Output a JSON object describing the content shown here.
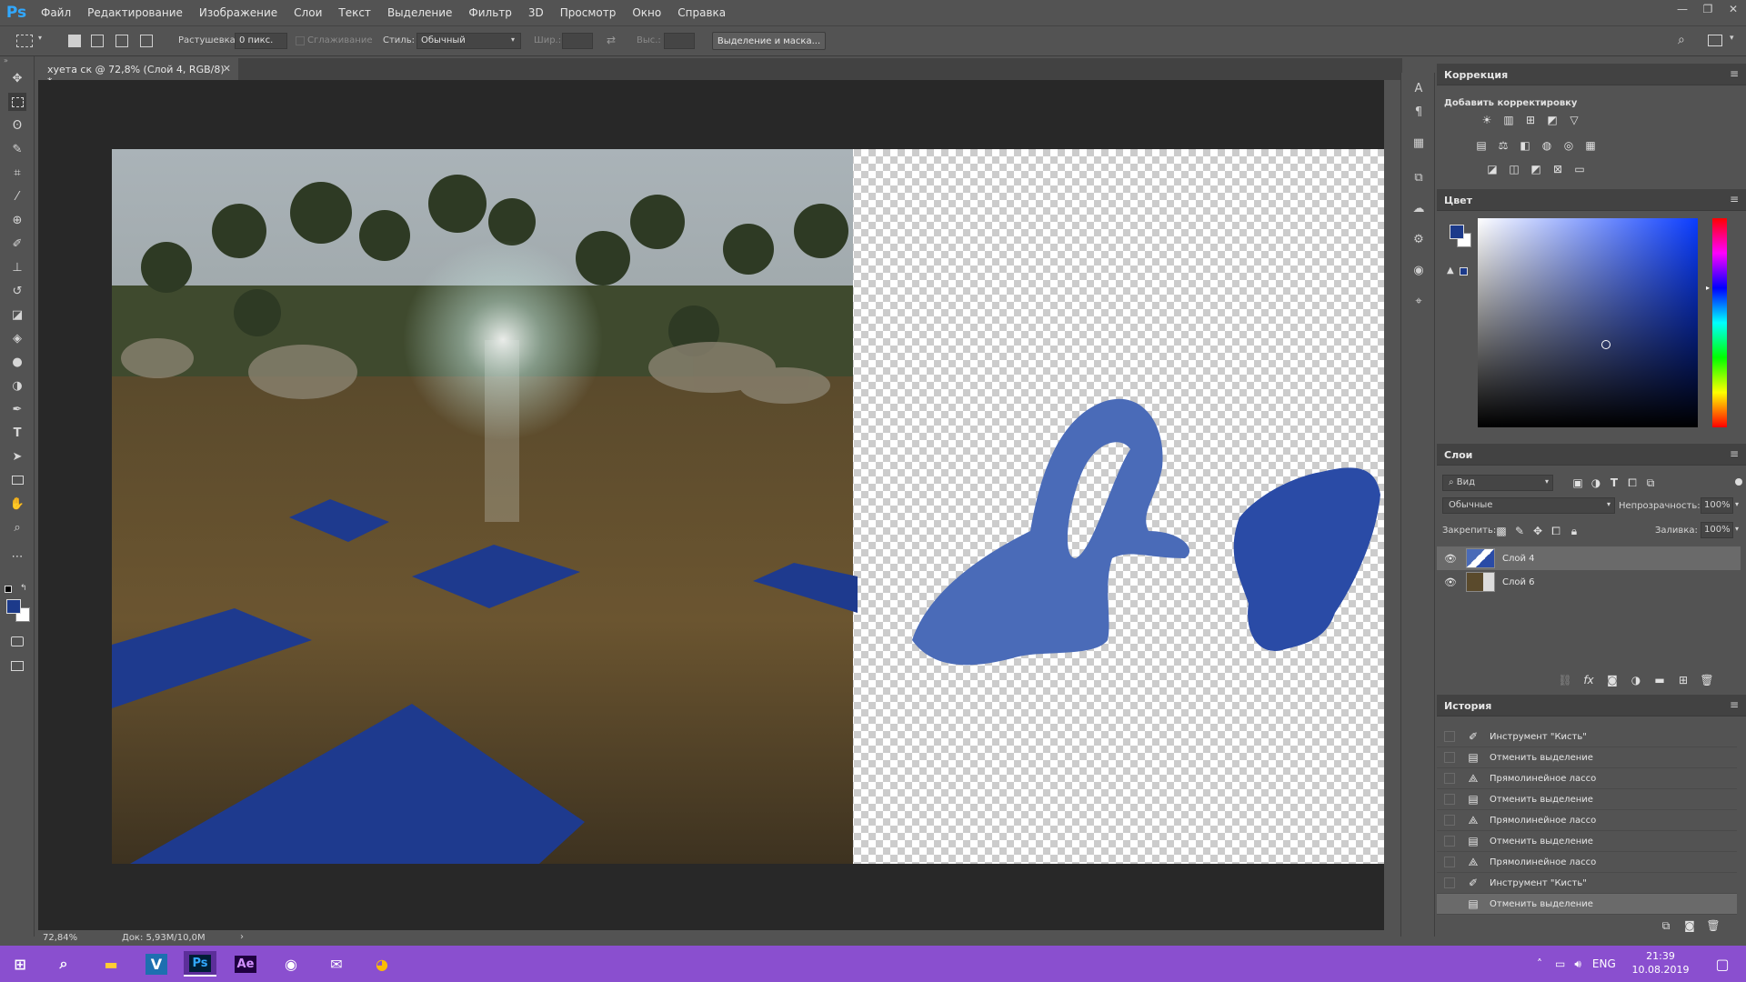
{
  "app": {
    "logo": "Ps",
    "menu": [
      "Файл",
      "Редактирование",
      "Изображение",
      "Слои",
      "Текст",
      "Выделение",
      "Фильтр",
      "3D",
      "Просмотр",
      "Окно",
      "Справка"
    ]
  },
  "options": {
    "feather_label": "Растушевка:",
    "feather_value": "0 пикс.",
    "antialias_label": "Сглаживание",
    "style_label": "Стиль:",
    "style_value": "Обычный",
    "width_label": "Шир.:",
    "height_label": "Выс.:",
    "select_mask_button": "Выделение и маска..."
  },
  "document": {
    "tab_title": "хуета ск @ 72,8% (Слой 4, RGB/8) *",
    "zoom": "72,84%",
    "doc_info": "Док: 5,93M/10,0M"
  },
  "adjustments": {
    "title": "Коррекция",
    "subtitle": "Добавить корректировку"
  },
  "color_panel": {
    "title": "Цвет",
    "foreground": "#1c3a8a",
    "background": "#ffffff"
  },
  "layers_panel": {
    "title": "Слои",
    "filter_label": "Вид",
    "blend_mode": "Обычные",
    "opacity_label": "Непрозрачность:",
    "opacity_value": "100%",
    "lock_label": "Закрепить:",
    "fill_label": "Заливка:",
    "fill_value": "100%",
    "layers": [
      {
        "name": "Слой 4",
        "selected": true
      },
      {
        "name": "Слой 6",
        "selected": false
      }
    ]
  },
  "history_panel": {
    "title": "История",
    "items": [
      {
        "label": "Инструмент \"Кисть\"",
        "icon": "brush-icon"
      },
      {
        "label": "Отменить выделение",
        "icon": "document-icon"
      },
      {
        "label": "Прямолинейное лассо",
        "icon": "lasso-icon"
      },
      {
        "label": "Отменить выделение",
        "icon": "document-icon"
      },
      {
        "label": "Прямолинейное лассо",
        "icon": "lasso-icon"
      },
      {
        "label": "Отменить выделение",
        "icon": "document-icon"
      },
      {
        "label": "Прямолинейное лассо",
        "icon": "lasso-icon"
      },
      {
        "label": "Инструмент \"Кисть\"",
        "icon": "brush-icon"
      },
      {
        "label": "Отменить выделение",
        "icon": "document-icon"
      }
    ]
  },
  "taskbar": {
    "lang": "ENG",
    "time": "21:39",
    "date": "10.08.2019",
    "apps": [
      "V",
      "Ps",
      "Ae"
    ]
  },
  "colors": {
    "accent_blue": "#1c3a8a",
    "taskbar": "#8a4fcf",
    "ps_blue": "#31a8ff"
  }
}
